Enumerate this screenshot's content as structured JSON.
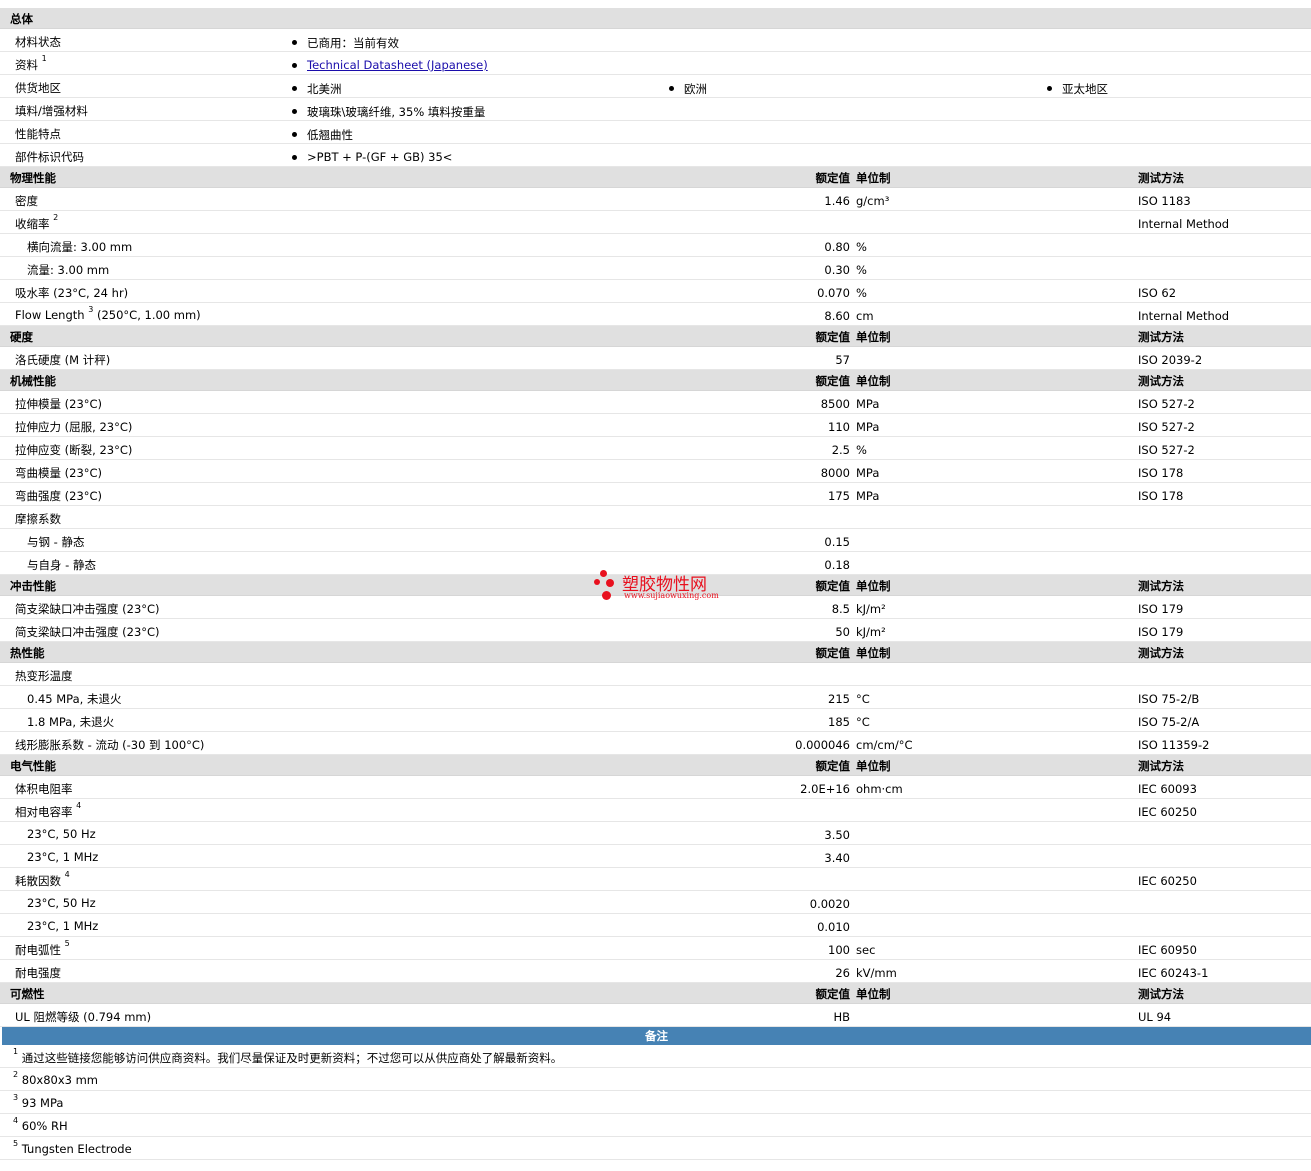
{
  "general": {
    "title": "总体",
    "rows": [
      {
        "label": "材料状态",
        "value": "已商用：当前有效"
      },
      {
        "label": "资料",
        "sup": "1",
        "link": "Technical Datasheet (Japanese)"
      },
      {
        "label": "供货地区",
        "values": [
          "北美洲",
          "欧洲",
          "亚太地区"
        ]
      },
      {
        "label": "填料/增强材料",
        "value": "玻璃珠\\玻璃纤维, 35% 填料按重量"
      },
      {
        "label": "性能特点",
        "value": "低翘曲性"
      },
      {
        "label": "部件标识代码",
        "value": ">PBT + P-(GF + GB) 35<"
      }
    ]
  },
  "headers": {
    "nominal": "额定值",
    "unit": "单位制",
    "method": "测试方法"
  },
  "sections": [
    {
      "title": "物理性能",
      "rows": [
        {
          "label": "密度",
          "value": "1.46",
          "unit": "g/cm³",
          "method": "ISO 1183"
        },
        {
          "label": "收缩率",
          "sup": "2",
          "value": "",
          "unit": "",
          "method": "Internal Method"
        },
        {
          "label": "横向流量: 3.00 mm",
          "sub": true,
          "value": "0.80",
          "unit": "%",
          "method": ""
        },
        {
          "label": "流量: 3.00 mm",
          "sub": true,
          "value": "0.30",
          "unit": "%",
          "method": ""
        },
        {
          "label": "吸水率 (23°C, 24 hr)",
          "value": "0.070",
          "unit": "%",
          "method": "ISO 62"
        },
        {
          "label": "Flow Length",
          "sup": "3",
          "after": " (250°C, 1.00 mm)",
          "value": "8.60",
          "unit": "cm",
          "method": "Internal Method"
        }
      ]
    },
    {
      "title": "硬度",
      "rows": [
        {
          "label": "洛氏硬度 (M 计秤)",
          "value": "57",
          "unit": "",
          "method": "ISO 2039-2"
        }
      ]
    },
    {
      "title": "机械性能",
      "rows": [
        {
          "label": "拉伸模量 (23°C)",
          "value": "8500",
          "unit": "MPa",
          "method": "ISO 527-2"
        },
        {
          "label": "拉伸应力 (屈服, 23°C)",
          "value": "110",
          "unit": "MPa",
          "method": "ISO 527-2"
        },
        {
          "label": "拉伸应变 (断裂, 23°C)",
          "value": "2.5",
          "unit": "%",
          "method": "ISO 527-2"
        },
        {
          "label": "弯曲模量 (23°C)",
          "value": "8000",
          "unit": "MPa",
          "method": "ISO 178"
        },
        {
          "label": "弯曲强度 (23°C)",
          "value": "175",
          "unit": "MPa",
          "method": "ISO 178"
        },
        {
          "label": "摩擦系数",
          "value": "",
          "unit": "",
          "method": ""
        },
        {
          "label": "与钢 - 静态",
          "sub": true,
          "value": "0.15",
          "unit": "",
          "method": ""
        },
        {
          "label": "与自身 - 静态",
          "sub": true,
          "value": "0.18",
          "unit": "",
          "method": ""
        }
      ]
    },
    {
      "title": "冲击性能",
      "rows": [
        {
          "label": "简支梁缺口冲击强度 (23°C)",
          "value": "8.5",
          "unit": "kJ/m²",
          "method": "ISO 179"
        },
        {
          "label": "简支梁缺口冲击强度 (23°C)",
          "value": "50",
          "unit": "kJ/m²",
          "method": "ISO 179"
        }
      ]
    },
    {
      "title": "热性能",
      "rows": [
        {
          "label": "热变形温度",
          "value": "",
          "unit": "",
          "method": ""
        },
        {
          "label": "0.45 MPa, 未退火",
          "sub": true,
          "value": "215",
          "unit": "°C",
          "method": "ISO 75-2/B"
        },
        {
          "label": "1.8 MPa, 未退火",
          "sub": true,
          "value": "185",
          "unit": "°C",
          "method": "ISO 75-2/A"
        },
        {
          "label": "线形膨胀系数 - 流动 (-30 到 100°C)",
          "value": "0.000046",
          "unit": "cm/cm/°C",
          "method": "ISO 11359-2"
        }
      ]
    },
    {
      "title": "电气性能",
      "rows": [
        {
          "label": "体积电阻率",
          "value": "2.0E+16",
          "unit": "ohm·cm",
          "method": "IEC 60093"
        },
        {
          "label": "相对电容率",
          "sup": "4",
          "value": "",
          "unit": "",
          "method": "IEC 60250"
        },
        {
          "label": "23°C, 50 Hz",
          "sub": true,
          "value": "3.50",
          "unit": "",
          "method": ""
        },
        {
          "label": "23°C, 1 MHz",
          "sub": true,
          "value": "3.40",
          "unit": "",
          "method": ""
        },
        {
          "label": "耗散因数",
          "sup": "4",
          "value": "",
          "unit": "",
          "method": "IEC 60250"
        },
        {
          "label": "23°C, 50 Hz",
          "sub": true,
          "value": "0.0020",
          "unit": "",
          "method": ""
        },
        {
          "label": "23°C, 1 MHz",
          "sub": true,
          "value": "0.010",
          "unit": "",
          "method": ""
        },
        {
          "label": "耐电弧性",
          "sup": "5",
          "value": "100",
          "unit": "sec",
          "method": "IEC 60950"
        },
        {
          "label": "耐电强度",
          "value": "26",
          "unit": "kV/mm",
          "method": "IEC 60243-1"
        }
      ]
    },
    {
      "title": "可燃性",
      "rows": [
        {
          "label": "UL 阻燃等级 (0.794 mm)",
          "value": "HB",
          "unit": "",
          "method": "UL 94"
        }
      ]
    }
  ],
  "notes": {
    "title": "备注",
    "items": [
      {
        "n": "1",
        "text": "通过这些链接您能够访问供应商资料。我们尽量保证及时更新资料；不过您可以从供应商处了解最新资料。"
      },
      {
        "n": "2",
        "text": "80x80x3 mm"
      },
      {
        "n": "3",
        "text": "93 MPa"
      },
      {
        "n": "4",
        "text": "60% RH"
      },
      {
        "n": "5",
        "text": "Tungsten Electrode"
      }
    ]
  },
  "watermark": {
    "name": "塑胶物性网",
    "url": "www.sujiaowuxing.com",
    "color": "#e8101e"
  },
  "colors": {
    "section_bg": "#e0e0e0",
    "notes_bar": "#4682b4",
    "link": "#1a0dab"
  }
}
